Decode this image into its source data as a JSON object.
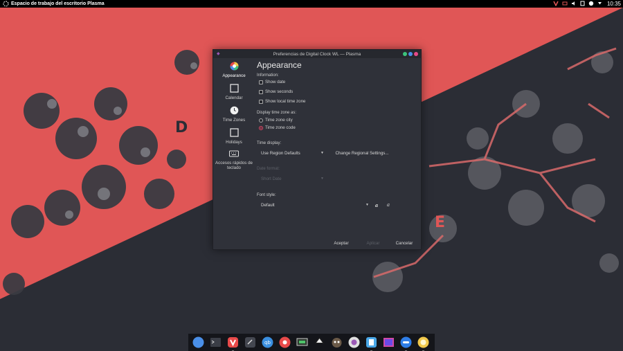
{
  "top_panel": {
    "title": "Espacio de trabajo del escritorio Plasma",
    "clock": "10:35"
  },
  "wallpaper": {
    "letter_left": "D",
    "letter_right": "E",
    "colors": {
      "coral": "#e05656",
      "dark": "#2b2d35"
    }
  },
  "dialog": {
    "title": "Preferencias de Digital Clock WL — Plasma",
    "sidebar": [
      {
        "label": "Appearance",
        "icon": "color-wheel-icon",
        "active": true
      },
      {
        "label": "Calendar",
        "icon": "calendar-icon"
      },
      {
        "label": "Time Zones",
        "icon": "clock-icon"
      },
      {
        "label": "Holidays",
        "icon": "holidays-icon"
      },
      {
        "label": "Accesos rápidos de teclado",
        "icon": "keyboard-icon"
      }
    ],
    "page_title": "Appearance",
    "information_label": "Information:",
    "checkboxes": {
      "show_date": "Show date",
      "show_seconds": "Show seconds",
      "show_local_time_zone": "Show local time zone"
    },
    "time_zone_label": "Display time zone as:",
    "radios": {
      "city": "Time zone city",
      "code": "Time zone code",
      "selected": "code"
    },
    "time_display_label": "Time display:",
    "time_display_value": "Use Region Defaults",
    "regional_button": "Change Regional Settings...",
    "date_format_label": "Date format:",
    "date_format_value": "Short Date",
    "font_style_label": "Font style:",
    "font_style_value": "Default",
    "bold_glyph": "a",
    "italic_glyph": "a",
    "buttons": {
      "ok": "Aceptar",
      "apply": "Aplicar",
      "cancel": "Cancelar"
    },
    "accent_color": "#e84a6a"
  },
  "dock": {
    "items": [
      "dolphin-icon",
      "konsole-icon",
      "vivaldi-icon",
      "kdevelop-icon",
      "qbittorrent-icon",
      "beach-ball-icon",
      "monitor-icon",
      "inkscape-icon",
      "gimp-icon",
      "color-picker-icon",
      "kdeconnect-icon",
      "image-viewer-icon",
      "toggle-icon",
      "sun-icon"
    ],
    "qb_label": "qb"
  }
}
